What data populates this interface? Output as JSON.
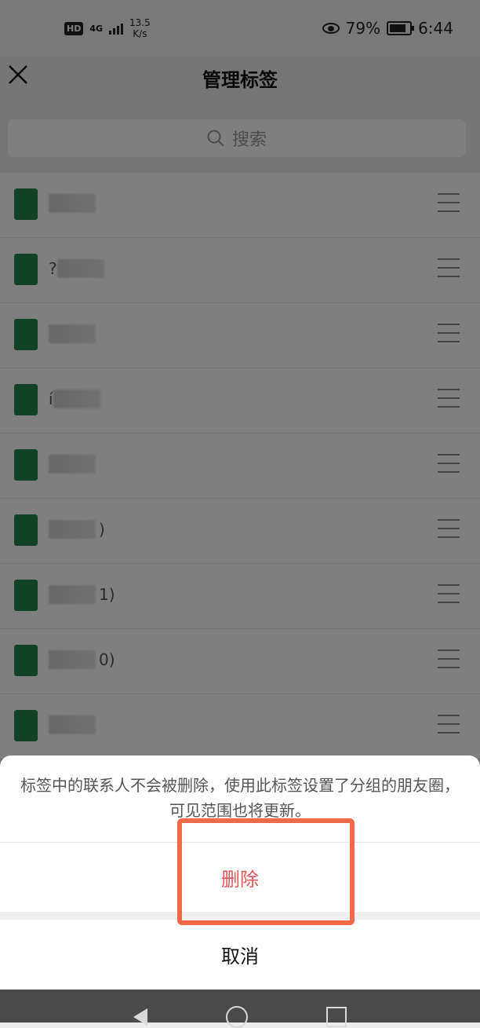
{
  "status_bar": {
    "hd": "HD",
    "network": "4G",
    "speed_value": "13.5",
    "speed_unit": "K/s",
    "battery": "79%",
    "time": "6:44"
  },
  "header": {
    "title": "管理标签"
  },
  "search": {
    "placeholder": "搜索"
  },
  "tags": [
    {
      "visible_text": ""
    },
    {
      "visible_text": "?"
    },
    {
      "visible_text": ""
    },
    {
      "visible_text": "í"
    },
    {
      "visible_text": ""
    },
    {
      "visible_text": ")"
    },
    {
      "visible_text": "1)"
    },
    {
      "visible_text": "0)"
    },
    {
      "visible_text": ""
    }
  ],
  "dialog": {
    "message": "标签中的联系人不会被删除，使用此标签设置了分组的朋友圈，可见范围也将更新。",
    "delete_label": "删除",
    "cancel_label": "取消"
  },
  "colors": {
    "tag_green": "#24844d",
    "delete_red": "#e05656",
    "highlight": "#f06a47"
  }
}
